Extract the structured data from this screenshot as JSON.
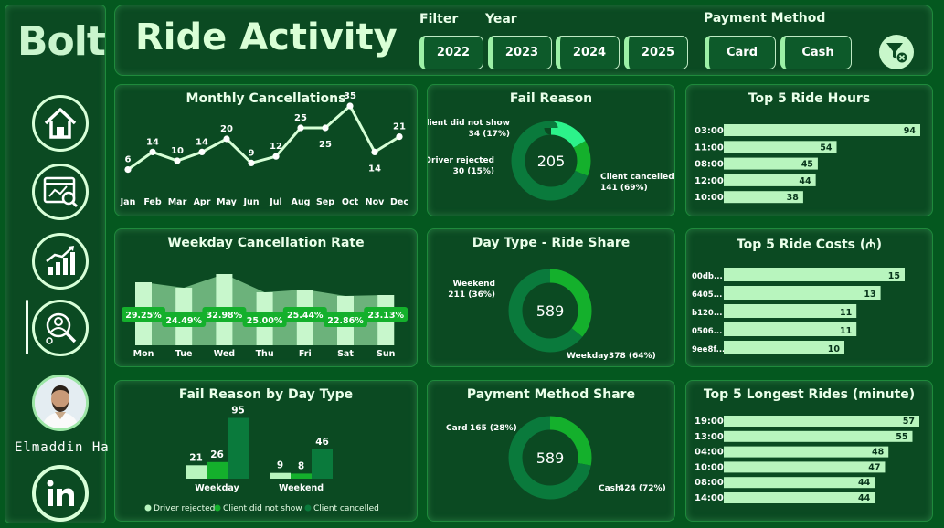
{
  "sidebar": {
    "logo": "Bolt",
    "user_name": "Elmaddin Ha",
    "icons": [
      "home-icon",
      "dashboard-analytics-icon",
      "growth-chart-icon",
      "people-search-icon"
    ]
  },
  "header": {
    "title": "Ride Activity",
    "filter_label": "Filter",
    "year_label": "Year",
    "payment_label": "Payment Method",
    "years": [
      "2022",
      "2023",
      "2024",
      "2025"
    ],
    "payments": [
      "Card",
      "Cash"
    ]
  },
  "colors": {
    "light": "#b8f5be",
    "mid": "#14b02c",
    "dark": "#0a7a3c",
    "accent": "#2cf28a",
    "line": "#d6ffd6"
  },
  "chart_data": [
    {
      "id": "monthly",
      "type": "line",
      "title": "Monthly Cancellations",
      "categories": [
        "Jan",
        "Feb",
        "Mar",
        "Apr",
        "May",
        "Jun",
        "Jul",
        "Aug",
        "Sep",
        "Oct",
        "Nov",
        "Dec"
      ],
      "values": [
        6,
        14,
        10,
        14,
        20,
        9,
        12,
        25,
        25,
        35,
        14,
        21
      ]
    },
    {
      "id": "fail",
      "type": "pie",
      "title": "Fail Reason",
      "center": "205",
      "slices": [
        {
          "label": "Client did not show",
          "value": 34,
          "text": "34 (17%)"
        },
        {
          "label": "Driver rejected",
          "value": 30,
          "text": "30 (15%)"
        },
        {
          "label": "Client cancelled",
          "value": 141,
          "text": "141 (69%)"
        }
      ]
    },
    {
      "id": "hours",
      "type": "bar",
      "title": "Top 5 Ride Hours",
      "categories": [
        "03:00",
        "11:00",
        "08:00",
        "12:00",
        "10:00"
      ],
      "values": [
        94,
        54,
        45,
        44,
        38
      ]
    },
    {
      "id": "weekday",
      "type": "area",
      "title": "Weekday Cancellation Rate",
      "categories": [
        "Mon",
        "Tue",
        "Wed",
        "Thu",
        "Fri",
        "Sat",
        "Sun"
      ],
      "values": [
        29.25,
        24.49,
        32.98,
        25.0,
        25.44,
        22.86,
        23.13
      ],
      "labels": [
        "29.25%",
        "24.49%",
        "32.98%",
        "25.00%",
        "25.44%",
        "22.86%",
        "23.13%"
      ]
    },
    {
      "id": "daytype",
      "type": "pie",
      "title": "Day Type - Ride Share",
      "center": "589",
      "slices": [
        {
          "label": "Weekend",
          "value": 211,
          "text": "211 (36%)"
        },
        {
          "label": "Weekday",
          "value": 378,
          "text": "378 (64%)"
        }
      ]
    },
    {
      "id": "costs",
      "type": "bar",
      "title": "Top 5 Ride Costs (₼)",
      "categories": [
        "00db...",
        "6405...",
        "b120...",
        "0506...",
        "9ee8f..."
      ],
      "values": [
        15,
        13,
        11,
        11,
        10
      ]
    },
    {
      "id": "failday",
      "type": "bar",
      "title": "Fail Reason by Day Type",
      "categories": [
        "Weekday",
        "Weekend"
      ],
      "series": [
        {
          "name": "Driver rejected",
          "values": [
            21,
            9
          ]
        },
        {
          "name": "Client did not show",
          "values": [
            26,
            8
          ]
        },
        {
          "name": "Client cancelled",
          "values": [
            95,
            46
          ]
        }
      ]
    },
    {
      "id": "payment",
      "type": "pie",
      "title": "Payment Method Share",
      "center": "589",
      "slices": [
        {
          "label": "Card",
          "value": 165,
          "text": "165 (28%)"
        },
        {
          "label": "Cash",
          "value": 424,
          "text": "424 (72%)"
        }
      ]
    },
    {
      "id": "longest",
      "type": "bar",
      "title": "Top 5 Longest Rides (minute)",
      "categories": [
        "19:00",
        "13:00",
        "04:00",
        "10:00",
        "08:00",
        "14:00"
      ],
      "values": [
        57,
        55,
        48,
        47,
        44,
        44
      ]
    }
  ]
}
